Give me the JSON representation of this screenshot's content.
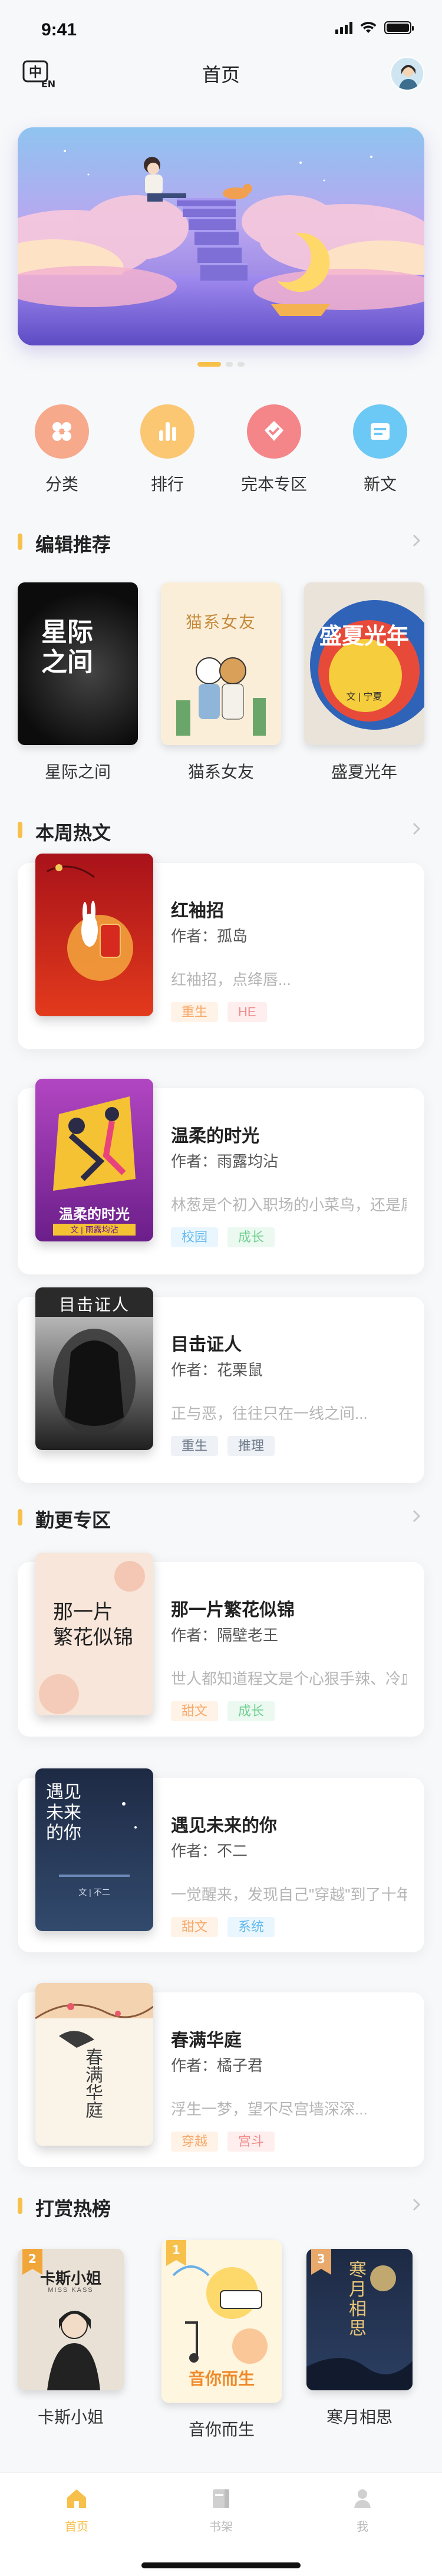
{
  "status": {
    "time": "9:41"
  },
  "header": {
    "title": "首页",
    "lang_badge": "EN",
    "lang_char": "中"
  },
  "quick_nav": [
    {
      "label": "分类",
      "icon": "category-icon",
      "color": "#f7a98b"
    },
    {
      "label": "排行",
      "icon": "ranking-icon",
      "color": "#fbc772"
    },
    {
      "label": "完本专区",
      "icon": "finished-icon",
      "color": "#f4868a"
    },
    {
      "label": "新文",
      "icon": "new-icon",
      "color": "#6cc8f5"
    }
  ],
  "editor_picks": {
    "title": "编辑推荐",
    "books": [
      {
        "title": "星际之间",
        "cover_text": "星际\n之间"
      },
      {
        "title": "猫系女友",
        "cover_text": "猫系女友"
      },
      {
        "title": "盛夏光年",
        "cover_text": "盛夏光年",
        "cover_sub": "文 | 宁夏"
      }
    ]
  },
  "weekly_hot": {
    "title": "本周热文",
    "books": [
      {
        "title": "红袖招",
        "author": "作者：孤岛",
        "desc": "红袖招，点绛唇...",
        "tags": [
          {
            "text": "重生",
            "color": "#f6a96a",
            "bg": "#fff3e8"
          },
          {
            "text": "HE",
            "color": "#f08b8b",
            "bg": "#ffeeee"
          }
        ]
      },
      {
        "title": "温柔的时光",
        "author": "作者：雨露均沾",
        "desc": "林葱是个初入职场的小菜鸟，还是属...",
        "cover_text": "温柔的时光",
        "cover_sub": "文 | 雨露均沾",
        "tags": [
          {
            "text": "校园",
            "color": "#63b9ec",
            "bg": "#eaf6fd"
          },
          {
            "text": "成长",
            "color": "#6fcf8f",
            "bg": "#ebf9f0"
          }
        ]
      },
      {
        "title": "目击证人",
        "author": "作者：花栗鼠",
        "desc": "正与恶，往往只在一线之间...",
        "cover_text": "目击证人",
        "tags": [
          {
            "text": "重生",
            "color": "#6f7b8c",
            "bg": "#eef1f5"
          },
          {
            "text": "推理",
            "color": "#6f7b8c",
            "bg": "#eef1f5"
          }
        ]
      }
    ]
  },
  "diligent": {
    "title": "勤更专区",
    "books": [
      {
        "title": "那一片繁花似锦",
        "author": "作者：隔壁老王",
        "desc": "世人都知道程文是个心狠手辣、冷血...",
        "cover_text": "那一片\n繁花似锦",
        "tags": [
          {
            "text": "甜文",
            "color": "#f6a96a",
            "bg": "#fff3e8"
          },
          {
            "text": "成长",
            "color": "#6fcf8f",
            "bg": "#ebf9f0"
          }
        ]
      },
      {
        "title": "遇见未来的你",
        "author": "作者：不二",
        "desc": "一觉醒来，发现自己\"穿越\"到了十年...",
        "cover_text": "遇见\n未来\n的你",
        "cover_sub": "文 | 不二",
        "tags": [
          {
            "text": "甜文",
            "color": "#f6a96a",
            "bg": "#fff3e8"
          },
          {
            "text": "系统",
            "color": "#63b9ec",
            "bg": "#eaf6fd"
          }
        ]
      },
      {
        "title": "春满华庭",
        "author": "作者：橘子君",
        "desc": "浮生一梦，望不尽宫墙深深...",
        "cover_text": "春满华庭",
        "tags": [
          {
            "text": "穿越",
            "color": "#f6a96a",
            "bg": "#fff3e8"
          },
          {
            "text": "宫斗",
            "color": "#f08b8b",
            "bg": "#ffeeee"
          }
        ]
      }
    ]
  },
  "reward_rank": {
    "title": "打赏热榜",
    "books": [
      {
        "rank": "2",
        "title": "卡斯小姐",
        "cover_text": "卡斯小姐",
        "cover_sub": "MISS KASS"
      },
      {
        "rank": "1",
        "title": "音你而生",
        "cover_text": "音你而生"
      },
      {
        "rank": "3",
        "title": "寒月相思",
        "cover_text": "寒\n月\n相\n思"
      }
    ]
  },
  "tab_bar": [
    {
      "label": "首页",
      "icon": "home-icon",
      "active": true
    },
    {
      "label": "书架",
      "icon": "bookshelf-icon",
      "active": false
    },
    {
      "label": "我",
      "icon": "profile-icon",
      "active": false
    }
  ],
  "colors": {
    "accent": "#f6c04b",
    "background": "#f7f8fa"
  }
}
